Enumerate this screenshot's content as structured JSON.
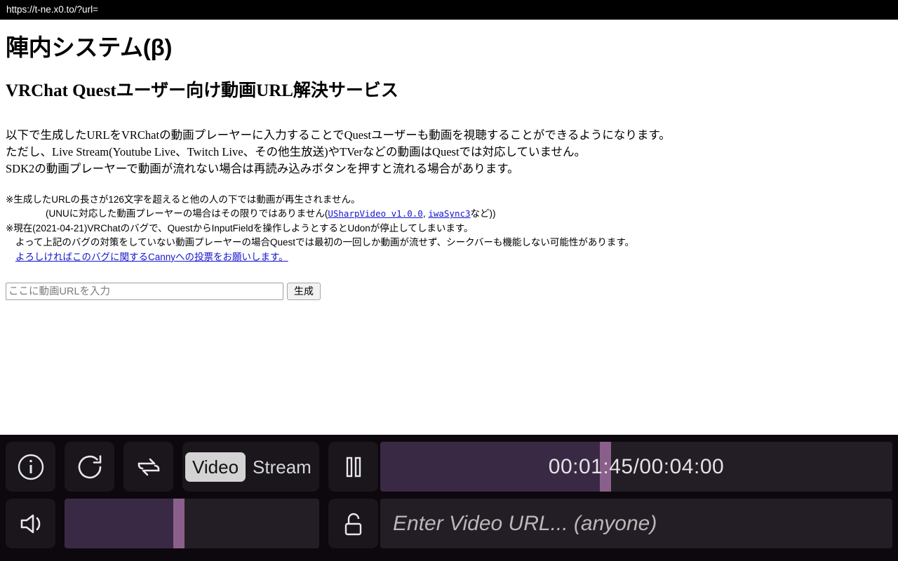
{
  "browser": {
    "url": "https://t-ne.x0.to/?url="
  },
  "page": {
    "site_title": "陣内システム(β)",
    "service_title": "VRChat Questユーザー向け動画URL解決サービス",
    "lead_lines": [
      "以下で生成したURLをVRChatの動画プレーヤーに入力することでQuestユーザーも動画を視聴することができるようになります。",
      "ただし、Live Stream(Youtube Live、Twitch Live、その他生放送)やTVerなどの動画はQuestでは対応していません。",
      "SDK2の動画プレーヤーで動画が流れない場合は再読み込みボタンを押すと流れる場合があります。"
    ],
    "notes": {
      "line1": "※生成したURLの長さが126文字を超えると他の人の下では動画が再生されません。",
      "line2_prefix": "(UNUに対応した動画プレーヤーの場合はその限りではありません(",
      "link_usharpvideo": "USharpVideo v1.0.0",
      "link_separator": ", ",
      "link_iwasync": "iwaSync3",
      "line2_suffix": "など))",
      "line3": "※現在(2021-04-21)VRChatのバグで、QuestからInputFieldを操作しようとするとUdonが停止してしまいます。",
      "line4": "よって上記のバグの対策をしていない動画プレーヤーの場合Questでは最初の一回しか動画が流せず、シークバーも機能しない可能性があります。",
      "link_canny": "よろしければこのバグに関するCannyへの投票をお願いします。"
    },
    "form": {
      "input_placeholder": "ここに動画URLを入力",
      "input_value": "",
      "generate_label": "生成"
    }
  },
  "player": {
    "icons": {
      "info": "info-icon",
      "reload": "reload-icon",
      "loop": "loop-icon",
      "volume": "volume-icon",
      "pause": "pause-icon",
      "lock": "unlock-icon"
    },
    "mode_toggle": {
      "video_label": "Video",
      "stream_label": "Stream",
      "selected": "Video"
    },
    "volume": {
      "percent": 45
    },
    "seek": {
      "current_time": "00:01:45",
      "total_time": "00:04:00",
      "time_label": "00:01:45/00:04:00",
      "percent": 44
    },
    "url_field": {
      "placeholder": "Enter Video URL... (anyone)",
      "value": ""
    },
    "colors": {
      "panel_bg": "#0d070e",
      "button_bg": "#1a161c",
      "track_bg": "#231d25",
      "fill": "#3a2944",
      "handle": "#8b5f8b",
      "toggle_active_bg": "#d3d3d3"
    }
  }
}
